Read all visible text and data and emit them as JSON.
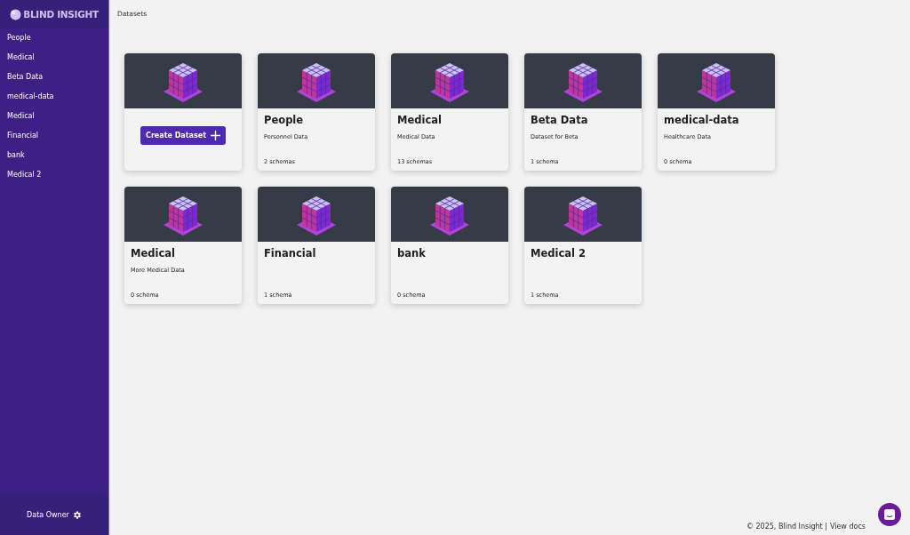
{
  "sidebar": {
    "logo": "BLIND INSIGHT",
    "items": [
      {
        "label": "People"
      },
      {
        "label": "Medical"
      },
      {
        "label": "Beta Data"
      },
      {
        "label": "medical-data"
      },
      {
        "label": "Medical"
      },
      {
        "label": "Financial"
      },
      {
        "label": "bank"
      },
      {
        "label": "Medical 2"
      }
    ],
    "user": "Data Owner"
  },
  "breadcrumb": "Datasets",
  "create_button": "Create Dataset",
  "datasets": [
    {
      "name": "People",
      "description": "Personnel Data",
      "schemas": "2 schemas"
    },
    {
      "name": "Medical",
      "description": "Medical Data",
      "schemas": "13 schemas"
    },
    {
      "name": "Beta Data",
      "description": "Dataset for Beta",
      "schemas": "1 schema"
    },
    {
      "name": "medical-data",
      "description": "Healthcare Data",
      "schemas": "0 schema"
    },
    {
      "name": "Medical",
      "description": "More Medical Data",
      "schemas": "0 schema"
    },
    {
      "name": "Financial",
      "schemas": "1 schema"
    },
    {
      "name": "bank",
      "schemas": "0 schema"
    },
    {
      "name": "Medical 2",
      "schemas": "1 schema"
    }
  ],
  "footer": {
    "copyright": "© 2025, Blind Insight |",
    "link": "View docs"
  }
}
